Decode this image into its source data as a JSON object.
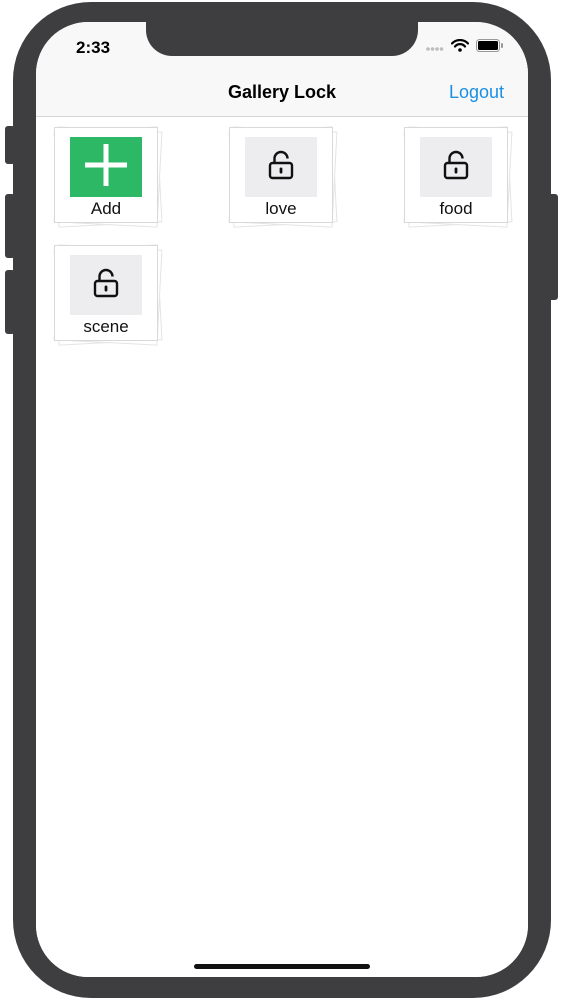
{
  "status_bar": {
    "time": "2:33",
    "icons": [
      "cellular-signal-icon",
      "wifi-icon",
      "battery-icon"
    ]
  },
  "nav": {
    "title": "Gallery Lock",
    "logout_label": "Logout",
    "accent_color": "#1a8fe3"
  },
  "albums": [
    {
      "label": "Add",
      "icon": "plus-icon",
      "type": "add",
      "color": "#2db866"
    },
    {
      "label": "love",
      "icon": "lock-icon",
      "type": "album"
    },
    {
      "label": "food",
      "icon": "lock-icon",
      "type": "album"
    },
    {
      "label": "scene",
      "icon": "lock-icon",
      "type": "album"
    }
  ]
}
